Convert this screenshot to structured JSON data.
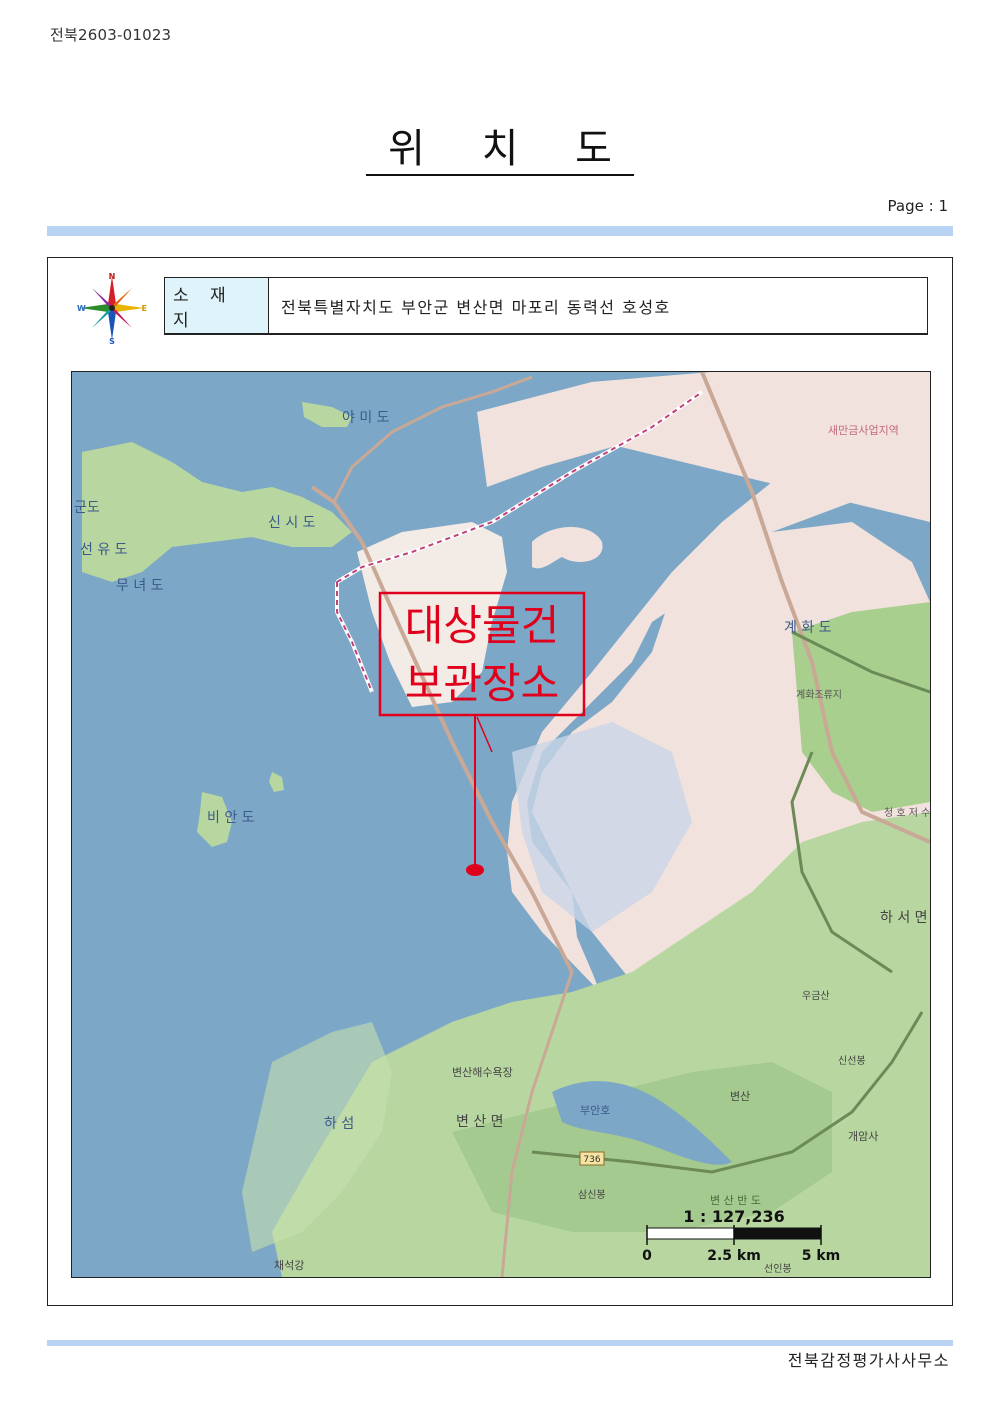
{
  "document": {
    "id": "전북2603-01023",
    "title": "위 치 도",
    "page_label": "Page  :  1",
    "footer": "전북감정평가사사무소"
  },
  "compass": {
    "n": "N",
    "s": "S",
    "e": "E",
    "w": "W"
  },
  "address": {
    "label": "소 재 지",
    "value": "전북특별자치도 부안군 변산면 마포리 동력선 호성호"
  },
  "map": {
    "callout": {
      "line1": "대상물건",
      "line2": "보관장소"
    },
    "place_labels": {
      "yamido": "야 미 도",
      "sinsido": "신 시 도",
      "gundo": "군도",
      "seonyudo": "선 유 도",
      "munyeodo": "무 녀 도",
      "bianDo": "비 안 도",
      "gyehwado": "계 화 도",
      "gyehwa_reservoir": "계화조류지",
      "cheongho_reservoir": "청 호 저 수",
      "haseo": "하 서 면",
      "saemangeum": "새만금사업지역",
      "hasom": "하 섬",
      "byeonsan_beach": "변산해수욕장",
      "byeonsan_myeon": "변 산 면",
      "buanho": "부안호",
      "byeonsan_mt": "변산",
      "gaeamsa": "개암사",
      "chaeseokgang": "채석강",
      "route": "736",
      "byeonsan_peninsula": "변 산 반 도",
      "ujaksan": "우금산",
      "yongjo": "신선봉",
      "sansin": "삼신봉",
      "seowon": "선인봉"
    },
    "scale": {
      "ratio": "1 : 127,236",
      "tick0": "0",
      "tick1": "2.5 km",
      "tick2": "5 km"
    },
    "colors": {
      "sea": "#7da7c7",
      "reclaimed": "#f2e2de",
      "forest": "#b8d7a0",
      "marker": "#e0001b"
    }
  }
}
